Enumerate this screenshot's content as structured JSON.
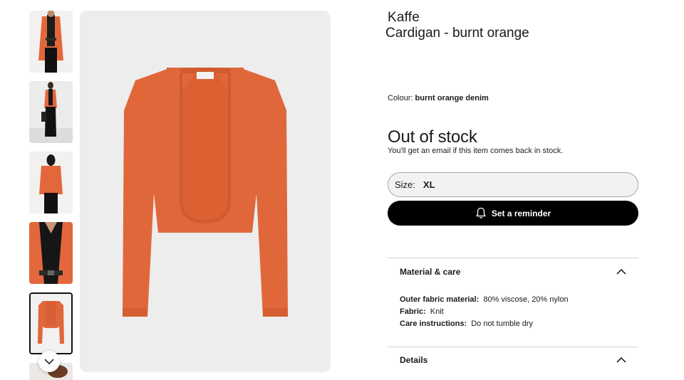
{
  "thumbnails": [
    {
      "name": "front on model"
    },
    {
      "name": "full length on model"
    },
    {
      "name": "back on model"
    },
    {
      "name": "detail close-up"
    },
    {
      "name": "packshot",
      "selected": true
    },
    {
      "name": "next image"
    }
  ],
  "product": {
    "brand": "Kaffe",
    "name": "Cardigan - burnt orange",
    "colour_label": "Colour:",
    "colour_value": "burnt orange denim",
    "color_hex": "#e0673a"
  },
  "stock": {
    "title": "Out of stock",
    "note": "You'll get an email if this item comes back in stock."
  },
  "size": {
    "label": "Size:",
    "value": "XL"
  },
  "reminder_button": {
    "label": "Set a reminder",
    "icon": "bell-icon"
  },
  "material_care": {
    "title": "Material & care",
    "expanded": true,
    "rows": [
      {
        "label": "Outer fabric material:",
        "value": "80% viscose, 20% nylon"
      },
      {
        "label": "Fabric:",
        "value": "Knit"
      },
      {
        "label": "Care instructions:",
        "value": "Do not tumble dry"
      }
    ]
  },
  "details": {
    "title": "Details"
  },
  "colors": {
    "accent": "#000000",
    "cardigan": "#e0673a",
    "image_bg": "#ededed"
  }
}
